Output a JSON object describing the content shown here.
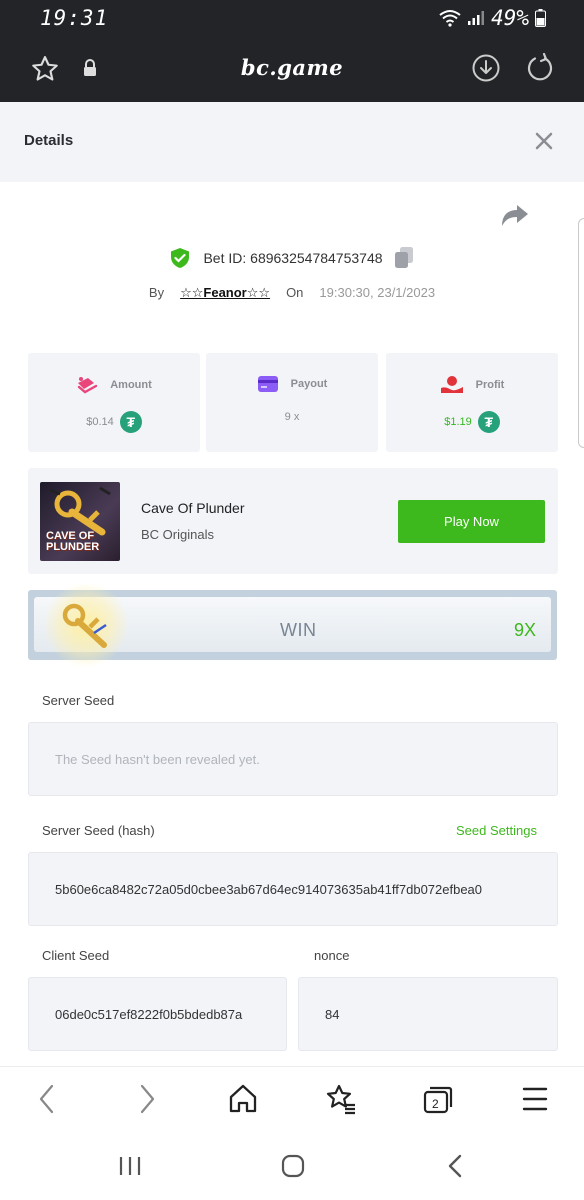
{
  "status_bar": {
    "time": "19:31",
    "battery": "49%"
  },
  "browser": {
    "url": "bc.game"
  },
  "details": {
    "title": "Details",
    "bet_id_label": "Bet ID: 68963254784753748",
    "by_label": "By",
    "username": "☆☆Feanor☆☆",
    "on_label": "On",
    "timestamp": "19:30:30, 23/1/2023"
  },
  "stats": {
    "amount": {
      "label": "Amount",
      "value": "$0.14"
    },
    "payout": {
      "label": "Payout",
      "value": "9 x"
    },
    "profit": {
      "label": "Profit",
      "value": "$1.19"
    }
  },
  "game": {
    "name": "Cave Of Plunder",
    "provider": "BC Originals",
    "thumb_text": "CAVE OF PLUNDER",
    "play_label": "Play Now"
  },
  "result": {
    "label": "WIN",
    "multiplier": "9X"
  },
  "seeds": {
    "server_seed_label": "Server Seed",
    "server_seed_value": "The Seed hasn't been revealed yet.",
    "server_hash_label": "Server Seed (hash)",
    "seed_settings_label": "Seed Settings",
    "server_hash_value": "5b60e6ca8482c72a05d0cbee3ab67d64ec914073635ab41ff7db072efbea0",
    "client_seed_label": "Client Seed",
    "client_seed_value": "06de0c517ef8222f0b5bdedb87a",
    "nonce_label": "nonce",
    "nonce_value": "84"
  },
  "colors": {
    "accent_green": "#3db81d",
    "card_bg": "#f3f4f8",
    "topbar_bg": "#232427",
    "tether": "#27a17a"
  },
  "icons": [
    "star-icon",
    "lock-icon",
    "download-icon",
    "reload-icon",
    "close-icon",
    "share-icon",
    "shield-check-icon",
    "copy-icon",
    "amount-icon",
    "payout-icon",
    "profit-icon",
    "tether-icon",
    "back-icon",
    "forward-icon",
    "home-icon",
    "bookmarks-icon",
    "tabs-icon",
    "menu-icon",
    "recents-icon",
    "system-home-icon",
    "system-back-icon"
  ]
}
